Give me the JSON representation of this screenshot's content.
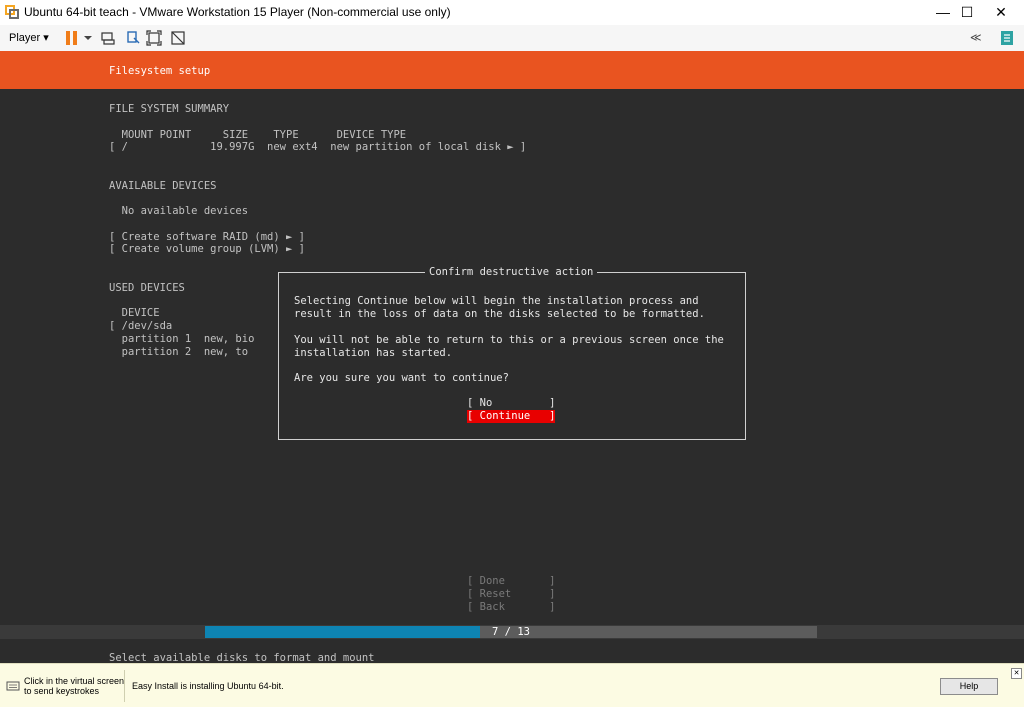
{
  "window": {
    "title": "Ubuntu 64-bit teach - VMware Workstation 15 Player (Non-commercial use only)",
    "minimize": "—",
    "maximize": "☐",
    "close": "✕"
  },
  "toolbar": {
    "player_menu": "Player ▾",
    "icons": [
      "pause-icon",
      "send-keys-icon",
      "removable-devices-icon",
      "fullscreen-icon",
      "unity-icon",
      "collapse-icon",
      "library-icon"
    ],
    "collapse_glyph": "≪"
  },
  "installer": {
    "header_title": "Filesystem setup",
    "fs_summary_heading": "FILE SYSTEM SUMMARY",
    "fs_columns": "  MOUNT POINT     SIZE    TYPE      DEVICE TYPE",
    "fs_row": "[ /             19.997G  new ext4  new partition of local disk ► ]",
    "available_heading": "AVAILABLE DEVICES",
    "no_devices": "  No available devices",
    "create_raid": "[ Create software RAID (md) ► ]",
    "create_lvm": "[ Create volume group (LVM) ► ]",
    "used_heading": "USED DEVICES",
    "used_device_col": "  DEVICE",
    "used_dev": "[ /dev/sda",
    "used_part1": "  partition 1  new, bio",
    "used_part2": "  partition 2  new, to",
    "done": "[ Done       ]",
    "reset": "[ Reset      ]",
    "back": "[ Back       ]",
    "progress_label": "7 / 13",
    "progress_fraction": 0.45,
    "footer_hint": "Select available disks to format and mount"
  },
  "dialog": {
    "title": "Confirm destructive action",
    "line1": "Selecting Continue below will begin the installation process and",
    "line2": "result in the loss of data on the disks selected to be formatted.",
    "line3": "You will not be able to return to this or a previous screen once the",
    "line4": "installation has started.",
    "question": "Are you sure you want to continue?",
    "no_button": "[ No         ]",
    "continue_button": "[ Continue   ]"
  },
  "statusbar": {
    "hint_line1": "Click in the virtual screen",
    "hint_line2": "to send keystrokes",
    "message": "Easy Install is installing Ubuntu 64-bit.",
    "help_button": "Help",
    "close_glyph": "✕"
  },
  "colors": {
    "ubuntu_orange": "#e95420",
    "terminal_bg": "#2c2c2c",
    "selected_button": "#e80000",
    "progress_blue": "#0e84b3",
    "statusbar_bg": "#fcfbe3"
  }
}
